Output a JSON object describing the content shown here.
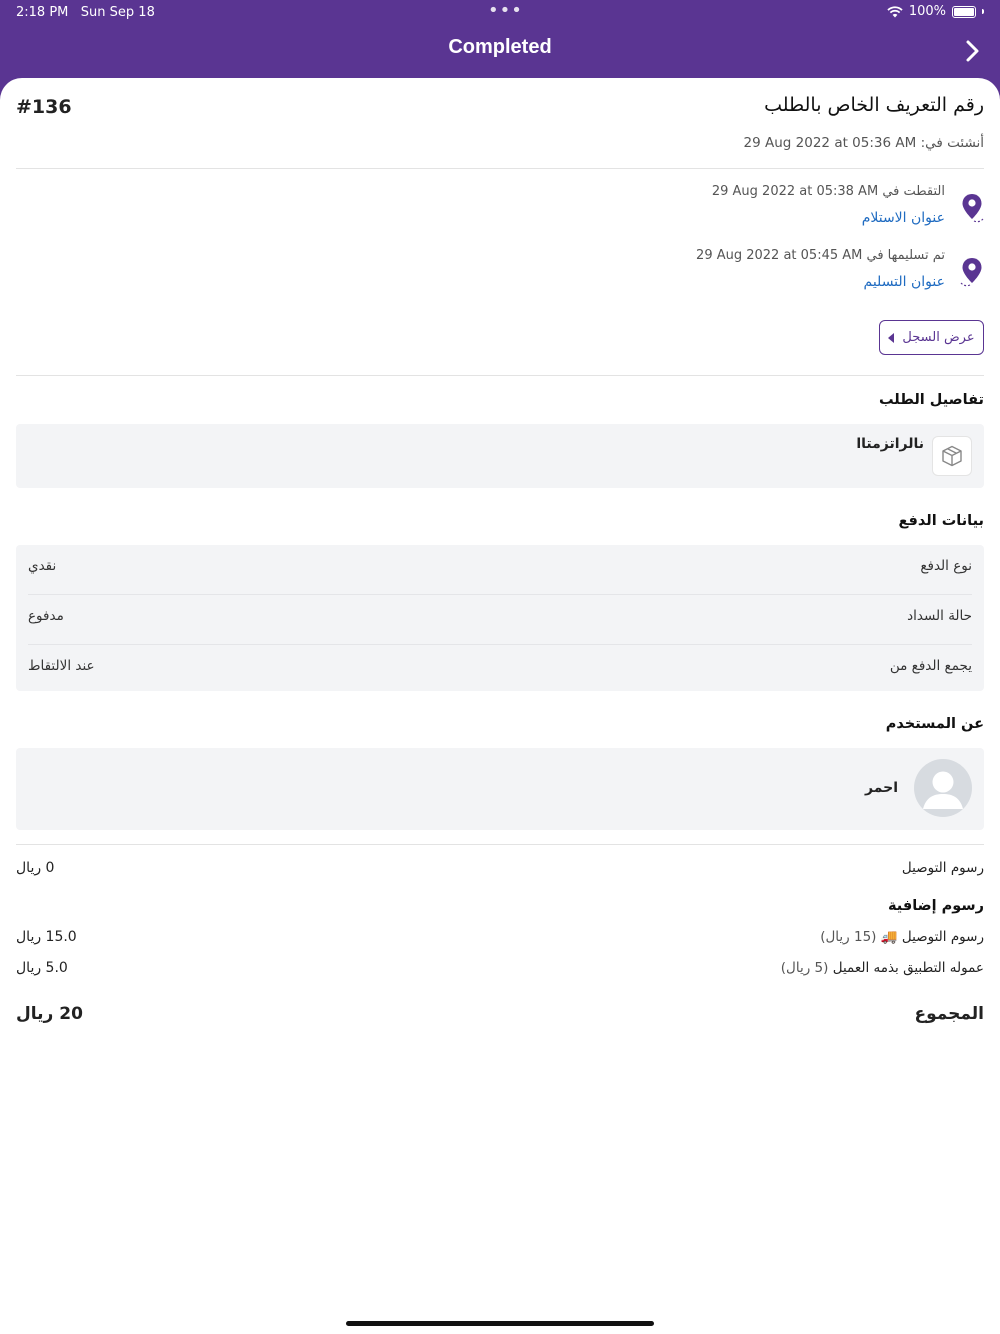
{
  "status_bar": {
    "time": "2:18 PM",
    "date": "Sun Sep 18",
    "dots": "•••",
    "battery": "100%"
  },
  "nav": {
    "title": "Completed",
    "next_icon": "chevron-right-icon"
  },
  "order": {
    "title": "رقم التعريف الخاص بالطلب",
    "id": "#136",
    "created_label": "أنشئت في:",
    "created_at": "29 Aug 2022 at 05:36 AM"
  },
  "route": {
    "pickup": {
      "stamp_label": "التقطت في",
      "stamp": "29 Aug 2022 at 05:38 AM",
      "link": "عنوان الاستلام",
      "icon": "location-pin-icon"
    },
    "dropoff": {
      "stamp_label": "تم تسليمها في",
      "stamp": "29 Aug 2022 at 05:45 AM",
      "link": "عنوان التسليم",
      "icon": "location-pin-icon"
    },
    "history_button": "عرض السجل"
  },
  "order_details": {
    "title": "تفاصيل الطلب",
    "package_name": "نالراتزمتاا",
    "icon": "package-box-icon"
  },
  "payment": {
    "title": "بيانات الدفع",
    "rows": [
      {
        "label": "نوع الدفع",
        "value": "نقدي"
      },
      {
        "label": "حالة السداد",
        "value": "مدفوع"
      },
      {
        "label": "يجمع الدفع من",
        "value": "عند الالتقاط"
      }
    ]
  },
  "user": {
    "title": "عن المستخدم",
    "name": "احمر",
    "icon": "avatar-placeholder-icon"
  },
  "fees": {
    "delivery_label": "رسوم التوصيل",
    "delivery_value": "0 ريال",
    "extra_title": "رسوم إضافية",
    "extra": [
      {
        "label": "رسوم  التوصيل",
        "emoji": "🚚",
        "paren": "(15 ريال)",
        "value": "15.0 ريال"
      },
      {
        "label": "عموله  التطبيق بذمه العميل",
        "emoji": "",
        "paren": "(5 ريال)",
        "value": "5.0 ريال"
      }
    ],
    "total_label": "المجموع",
    "total_value": "20 ريال"
  },
  "colors": {
    "brand": "#5a3592",
    "link": "#1f6bc1",
    "card": "#f3f4f6"
  }
}
